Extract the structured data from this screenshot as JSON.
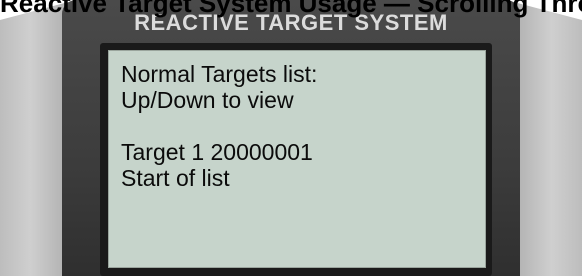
{
  "heading": "Reactive Target System Usage — Scrolling Through a Target List",
  "device": {
    "brand": "REACTIVE TARGET SYSTEM"
  },
  "screen": {
    "lines": [
      "Normal Targets list:",
      "Up/Down to view",
      "",
      "Target 1 20000001",
      "Start of list"
    ]
  },
  "colors": {
    "device_body": "#3c3c3c",
    "lcd_background": "#c6d4cb",
    "brand_text": "#dcdcdc"
  }
}
